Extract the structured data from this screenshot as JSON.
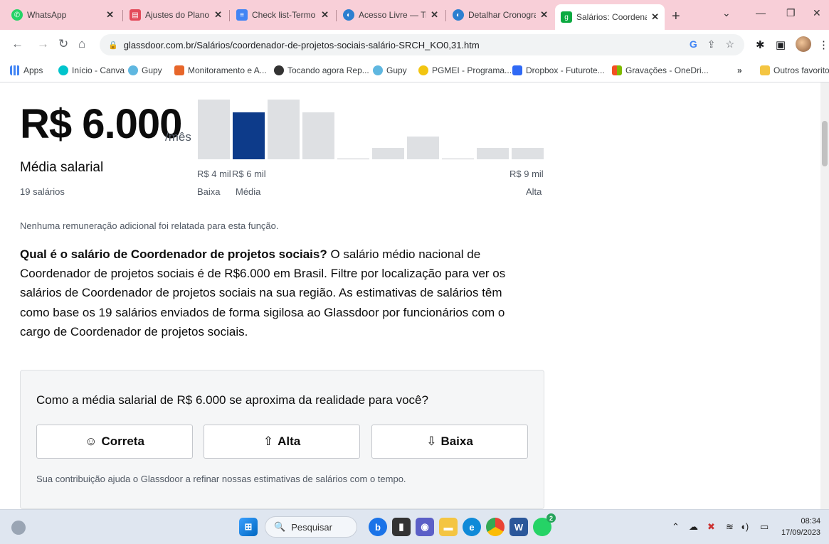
{
  "browser": {
    "tabs": [
      {
        "title": "WhatsApp",
        "icon": "whatsapp-icon",
        "color": "#25d366"
      },
      {
        "title": "Ajustes do Plano dè",
        "icon": "app-icon",
        "color": "#e34b5a"
      },
      {
        "title": "Check list-Termo dè",
        "icon": "docs-icon",
        "color": "#4285f4"
      },
      {
        "title": "Acesso Livre — Trar",
        "icon": "globe-icon",
        "color": "#2d7fd0"
      },
      {
        "title": "Detalhar Cronogran",
        "icon": "globe-icon",
        "color": "#2d7fd0"
      },
      {
        "title": "Salários: Coordenac",
        "icon": "glassdoor-icon",
        "color": "#0caa41"
      }
    ],
    "new_tab": "+",
    "url": "glassdoor.com.br/Salários/coordenador-de-projetos-sociais-salário-SRCH_KO0,31.htm",
    "bookmarks": [
      {
        "label": "Apps",
        "icon": "apps-grid-icon",
        "color": "#4285f4"
      },
      {
        "label": "Início - Canva",
        "icon": "canva-icon",
        "color": "#00c4cc"
      },
      {
        "label": "Gupy",
        "icon": "gupy-icon",
        "color": "#5fb7e0"
      },
      {
        "label": "Monitoramento e A...",
        "icon": "monitor-icon",
        "color": "#e7662a"
      },
      {
        "label": "Tocando agora Rep...",
        "icon": "music-icon",
        "color": "#333333"
      },
      {
        "label": "Gupy",
        "icon": "gupy-icon",
        "color": "#5fb7e0"
      },
      {
        "label": "PGMEI - Programa...",
        "icon": "pgmei-icon",
        "color": "#f2c511"
      },
      {
        "label": "Dropbox - Futurote...",
        "icon": "dropbox-icon",
        "color": "#2f69f5"
      },
      {
        "label": "Gravações - OneDri...",
        "icon": "onedrive-icon",
        "color": "#f25022"
      },
      {
        "label": "Outros favoritos",
        "icon": "folder-icon",
        "color": "#f4c542"
      }
    ],
    "bookmarks_more": "»"
  },
  "salary": {
    "amount": "R$ 6.000",
    "period": "/mês",
    "avg_label": "Média salarial",
    "count_label": "19 salários",
    "low_value": "R$ 4 mil",
    "avg_value": "R$ 6 mil",
    "high_value": "R$ 9 mil",
    "low_label": "Baixa",
    "avg_short": "Média",
    "high_label": "Alta",
    "no_extra": "Nenhuma remuneração adicional foi relatada para esta função.",
    "highlight_color": "#0d3b8a"
  },
  "chart_data": {
    "type": "bar",
    "categories": [
      "1",
      "2",
      "3",
      "4",
      "5",
      "6",
      "7",
      "8",
      "9",
      "10"
    ],
    "values": [
      84,
      66,
      84,
      66,
      1,
      16,
      32,
      1,
      16,
      16
    ],
    "highlighted_index": 1,
    "title": "",
    "xlabel": "",
    "ylabel": ""
  },
  "question": {
    "bold": "Qual é o salário de Coordenador de projetos sociais?",
    "text": " O salário médio nacional de Coordenador de projetos sociais é de R$6.000 em Brasil. Filtre por localização para ver os salários de Coordenador de projetos sociais na sua região. As estimativas de salários têm como base os 19 salários enviados de forma sigilosa ao Glassdoor por funcionários com o cargo de Coordenador de projetos sociais."
  },
  "feedback": {
    "question": "Como a média salarial de R$ 6.000 se aproxima da realidade para você?",
    "btn_correct": "Correta",
    "btn_high": "Alta",
    "btn_low": "Baixa",
    "note": "Sua contribuição ajuda o Glassdoor a refinar nossas estimativas de salários com o tempo."
  },
  "taskbar": {
    "search_placeholder": "Pesquisar",
    "time": "08:34",
    "date": "17/09/2023",
    "whatsapp_badge": "2"
  }
}
